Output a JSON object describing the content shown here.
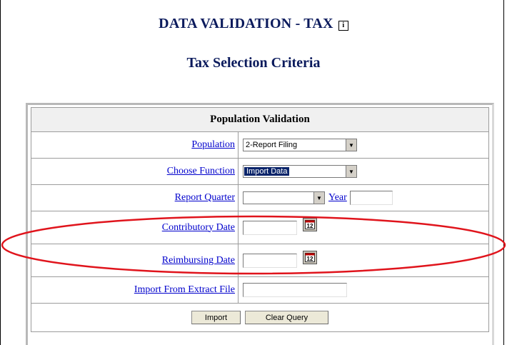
{
  "page": {
    "title": "DATA VALIDATION - TAX",
    "info_icon_glyph": "i",
    "subtitle": "Tax Selection Criteria"
  },
  "panel": {
    "header": "Population Validation",
    "population": {
      "label": "Population",
      "value": "2-Report Filing"
    },
    "choose_function": {
      "label": "Choose Function",
      "value": "Import Data"
    },
    "report_quarter": {
      "label": "Report Quarter",
      "value": "",
      "year_label": "Year",
      "year_value": ""
    },
    "contributory_date": {
      "label": "Contributory Date",
      "value": ""
    },
    "reimbursing_date": {
      "label": "Reimbursing Date",
      "value": ""
    },
    "import_file": {
      "label": "Import From Extract File",
      "value": ""
    },
    "buttons": {
      "import": "Import",
      "clear": "Clear Query"
    }
  },
  "colors": {
    "title": "#0a1a5c",
    "link": "#0000cc",
    "annotation": "#e0141c"
  },
  "icons": [
    "info-icon",
    "dropdown-arrow-icon",
    "calendar-icon"
  ]
}
